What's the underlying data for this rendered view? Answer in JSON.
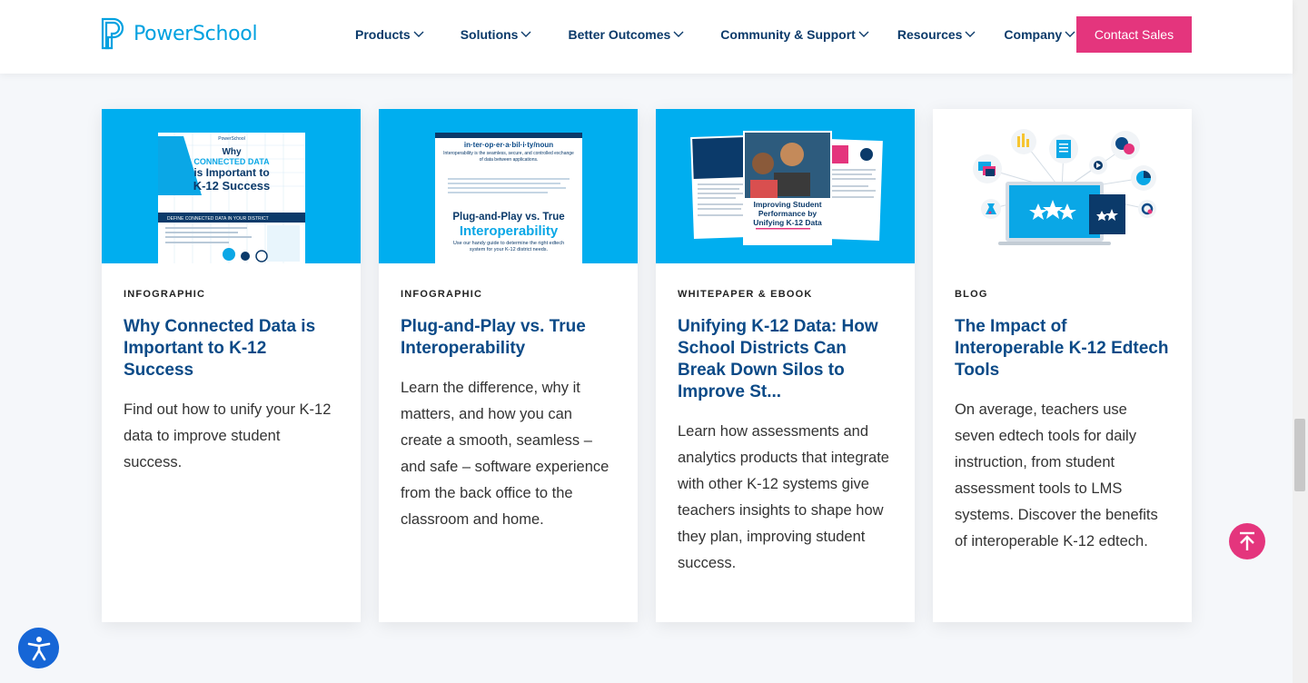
{
  "header": {
    "logo_text": "PowerSchool",
    "nav": [
      {
        "label": "Products"
      },
      {
        "label": "Solutions"
      },
      {
        "label": "Better Outcomes"
      },
      {
        "label": "Community & Support"
      },
      {
        "label": "Resources"
      },
      {
        "label": "Company"
      }
    ],
    "cta_label": "Contact Sales"
  },
  "cards": [
    {
      "type": "INFOGRAPHIC",
      "title": "Why Connected Data is Important to K-12 Success",
      "description": "Find out how to unify your K-12 data to improve student success.",
      "image": {
        "brand": "PowerSchool",
        "line1": "Why",
        "line2": "CONNECTED DATA",
        "line3": "is Important to",
        "line4": "K-12 Success",
        "section": "DEFINE CONNECTED DATA IN YOUR DISTRICT"
      }
    },
    {
      "type": "INFOGRAPHIC",
      "title": "Plug-and-Play vs. True Interoperability",
      "description": "Learn the difference, why it matters, and how you can create a smooth, seamless – and safe – software experience from the back office to the classroom and home.",
      "image": {
        "heading": "in·ter·op·er·a·bil·i·ty/noun",
        "definition": "Interoperability is the seamless, secure, and controlled exchange of data between applications.",
        "big1": "Plug-and-Play vs. True",
        "big2": "Interoperability",
        "caption": "Use our handy guide to determine the right edtech system for your K-12 district needs."
      }
    },
    {
      "type": "WHITEPAPER & EBOOK",
      "title": "Unifying K-12 Data: How School Districts Can Break Down Silos to Improve St...",
      "description": "Learn how assessments and analytics products that integrate with other K-12 systems give teachers insights to shape how they plan, improving student success.",
      "image": {
        "cover_title": "Improving Student Performance by Unifying K-12 Data"
      }
    },
    {
      "type": "BLOG",
      "title": "The Impact of Interoperable K-12 Edtech Tools",
      "description": "On average, teachers use seven edtech tools for daily instruction, from student assessment tools to LMS systems. Discover the benefits of interoperable K-12 edtech."
    }
  ],
  "colors": {
    "brand_blue": "#00a1e0",
    "nav_text": "#0b3a6a",
    "title_text": "#0b4a87",
    "cta": "#e4357d",
    "card_image_bg": "#00aeef",
    "accessibility": "#1666d6"
  },
  "icons": {
    "to_top": "arrow-up-to-line-icon",
    "accessibility": "accessibility-person-icon",
    "nav_chevron": "chevron-down-icon"
  }
}
